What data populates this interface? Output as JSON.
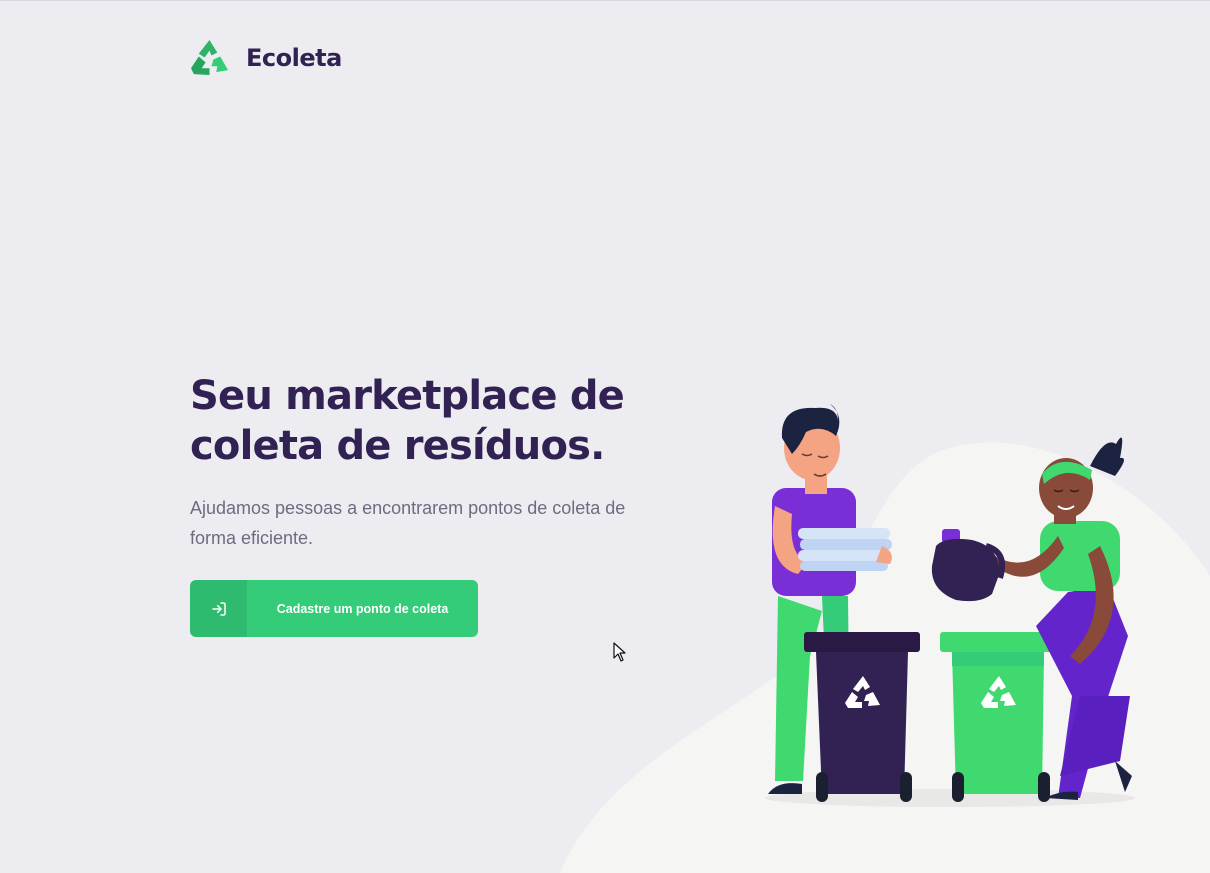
{
  "header": {
    "logo_icon": "recycle-icon",
    "brand": "Ecoleta"
  },
  "hero": {
    "title_line1": "Seu marketplace de",
    "title_line2": "coleta de resíduos.",
    "subtitle": "Ajudamos pessoas a encontrarem pontos de coleta de forma eficiente."
  },
  "cta": {
    "icon": "log-in-icon",
    "label": "Cadastre um ponto de coleta"
  },
  "colors": {
    "background": "#ededf1",
    "primary": "#34cb79",
    "title": "#322153",
    "text": "#6c6c80"
  }
}
